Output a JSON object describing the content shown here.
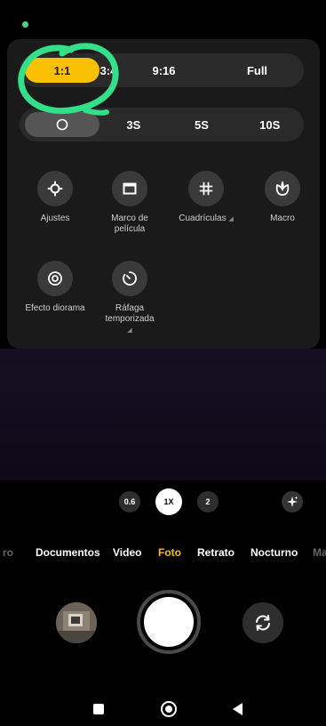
{
  "aspect_ratio": {
    "items": [
      {
        "label": "1:1",
        "selected": true
      },
      {
        "label": "3:4"
      },
      {
        "label": "9:16"
      },
      {
        "label": "Full"
      }
    ]
  },
  "timer": {
    "items": [
      {
        "label": ""
      },
      {
        "label": "3S"
      },
      {
        "label": "5S"
      },
      {
        "label": "10S"
      }
    ]
  },
  "options": {
    "ajustes": "Ajustes",
    "marco": "Marco de película",
    "cuadriculas": "Cuadrículas",
    "macro": "Macro",
    "diorama": "Efecto diorama",
    "rafaga": "Ráfaga temporizada"
  },
  "zoom": {
    "z06": "0.6",
    "z1": "1X",
    "z2": "2"
  },
  "modes": {
    "prev_partial": "ro",
    "documentos": "Documentos",
    "video": "Video",
    "foto": "Foto",
    "retrato": "Retrato",
    "nocturno": "Nocturno",
    "next_partial": "Ma"
  },
  "colors": {
    "accent": "#f9c100",
    "annotation": "#33e08a"
  }
}
